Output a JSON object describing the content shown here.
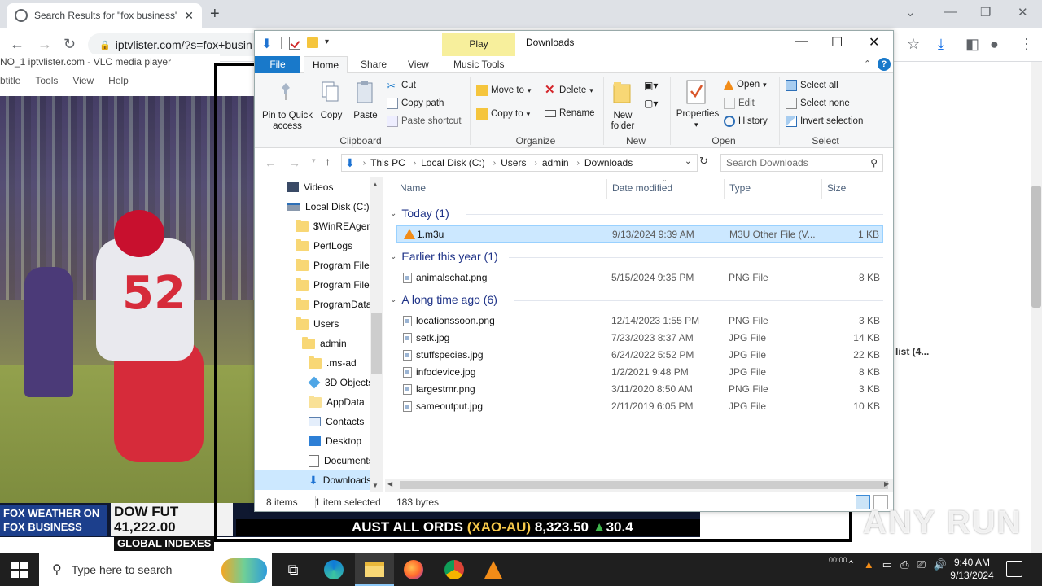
{
  "chrome": {
    "tab_title": "Search Results for \"fox business\"",
    "url": "iptvlister.com/?s=fox+busin",
    "right_page_text": "list (4..."
  },
  "vlc": {
    "title": "NO_1 iptvlister.com - VLC media player",
    "menu": [
      "btitle",
      "Tools",
      "View",
      "Help"
    ],
    "jersey_number": "52",
    "ticker": {
      "logo_top": "FOX WEATHER",
      "logo_on": "ON",
      "logo_bottom": "FOX BUSINESS",
      "dow_label": "DOW FUT",
      "dow_value": "41,222.00",
      "global": "GLOBAL INDEXES",
      "aust_label": "AUST ALL ORDS",
      "aust_code": "(XAO-AU)",
      "aust_value": "8,323.50",
      "aust_change": "30.4"
    }
  },
  "explorer": {
    "play_tab": "Play",
    "title": "Downloads",
    "ribbon_tabs": [
      "File",
      "Home",
      "Share",
      "View",
      "Music Tools"
    ],
    "clipboard": {
      "pin": "Pin to Quick access",
      "copy": "Copy",
      "paste": "Paste",
      "cut": "Cut",
      "copy_path": "Copy path",
      "paste_shortcut": "Paste shortcut",
      "label": "Clipboard"
    },
    "organize": {
      "move_to": "Move to",
      "copy_to": "Copy to",
      "delete": "Delete",
      "rename": "Rename",
      "label": "Organize"
    },
    "new": {
      "new_folder": "New folder",
      "label": "New"
    },
    "open": {
      "properties": "Properties",
      "open": "Open",
      "edit": "Edit",
      "history": "History",
      "label": "Open"
    },
    "select": {
      "select_all": "Select all",
      "select_none": "Select none",
      "invert": "Invert selection",
      "label": "Select"
    },
    "breadcrumb": [
      "This PC",
      "Local Disk (C:)",
      "Users",
      "admin",
      "Downloads"
    ],
    "search_placeholder": "Search Downloads",
    "nav": [
      {
        "label": "Videos"
      },
      {
        "label": "Local Disk (C:)"
      },
      {
        "label": "$WinREAgent"
      },
      {
        "label": "PerfLogs"
      },
      {
        "label": "Program Files"
      },
      {
        "label": "Program Files"
      },
      {
        "label": "ProgramData"
      },
      {
        "label": "Users"
      },
      {
        "label": "admin"
      },
      {
        "label": ".ms-ad"
      },
      {
        "label": "3D Objects"
      },
      {
        "label": "AppData"
      },
      {
        "label": "Contacts"
      },
      {
        "label": "Desktop"
      },
      {
        "label": "Documents"
      },
      {
        "label": "Downloads"
      }
    ],
    "columns": [
      "Name",
      "Date modified",
      "Type",
      "Size"
    ],
    "groups": [
      {
        "label": "Today (1)"
      },
      {
        "label": "Earlier this year (1)"
      },
      {
        "label": "A long time ago (6)"
      }
    ],
    "files": [
      {
        "name": "1.m3u",
        "date": "9/13/2024 9:39 AM",
        "type": "M3U Other File (V...",
        "size": "1 KB"
      },
      {
        "name": "animalschat.png",
        "date": "5/15/2024 9:35 PM",
        "type": "PNG File",
        "size": "8 KB"
      },
      {
        "name": "locationssoon.png",
        "date": "12/14/2023 1:55 PM",
        "type": "PNG File",
        "size": "3 KB"
      },
      {
        "name": "setk.jpg",
        "date": "7/23/2023 8:37 AM",
        "type": "JPG File",
        "size": "14 KB"
      },
      {
        "name": "stuffspecies.jpg",
        "date": "6/24/2022 5:52 PM",
        "type": "JPG File",
        "size": "22 KB"
      },
      {
        "name": "infodevice.jpg",
        "date": "1/2/2021 9:48 PM",
        "type": "JPG File",
        "size": "8 KB"
      },
      {
        "name": "largestmr.png",
        "date": "3/11/2020 8:50 AM",
        "type": "PNG File",
        "size": "3 KB"
      },
      {
        "name": "sameoutput.jpg",
        "date": "2/11/2019 6:05 PM",
        "type": "JPG File",
        "size": "10 KB"
      }
    ],
    "status": {
      "items": "8 items",
      "selected": "1 item selected",
      "size": "183 bytes"
    }
  },
  "watermark": "ANY RUN",
  "taskbar": {
    "search_placeholder": "Type here to search",
    "time": "9:40 AM",
    "date": "9/13/2024",
    "tray_time_small": "00:00"
  },
  "colors": {
    "file_tab": "#1979ca",
    "selection": "#cce8ff",
    "play_tab": "#f7ef9c",
    "group_header": "#1e3287"
  }
}
